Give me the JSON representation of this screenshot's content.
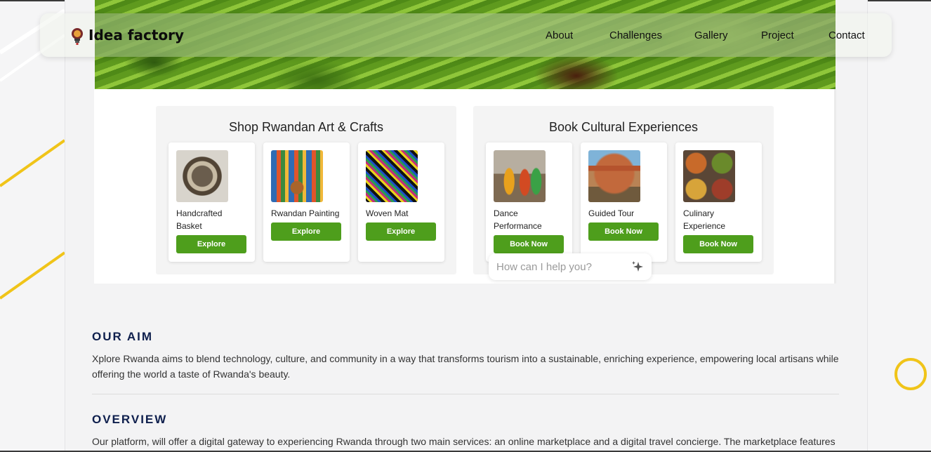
{
  "navbar": {
    "brand": "Idea factory",
    "logo_icon": "lightbulb-icon",
    "links": [
      "About",
      "Challenges",
      "Gallery",
      "Project",
      "Contact"
    ]
  },
  "shop": {
    "title": "Shop Rwandan Art & Crafts",
    "items": [
      {
        "name": "Handcrafted Basket",
        "button": "Explore"
      },
      {
        "name": "Rwandan Painting",
        "button": "Explore"
      },
      {
        "name": "Woven Mat",
        "button": "Explore"
      }
    ]
  },
  "experiences": {
    "title": "Book Cultural Experiences",
    "items": [
      {
        "name": "Dance Performance",
        "button": "Book Now"
      },
      {
        "name": "Guided Tour",
        "button": "Book Now"
      },
      {
        "name": "Culinary Experience",
        "button": "Book Now"
      }
    ]
  },
  "chat": {
    "placeholder": "How can I help you?",
    "icon": "sparkle-icon"
  },
  "aim": {
    "title": "OUR AIM",
    "text": "Xplore Rwanda aims to blend technology, culture, and community in a way that transforms tourism into a sustainable, enriching experience, empowering local artisans while offering the world a taste of Rwanda's beauty."
  },
  "overview": {
    "title": "OVERVIEW",
    "text": "Our platform, will offer a digital gateway to experiencing Rwanda through two main services: an online marketplace and a digital travel concierge. The marketplace features"
  },
  "colors": {
    "accent_green": "#4e9e1c",
    "heading_navy": "#0e1f4d",
    "deco_yellow": "#f0c419"
  }
}
